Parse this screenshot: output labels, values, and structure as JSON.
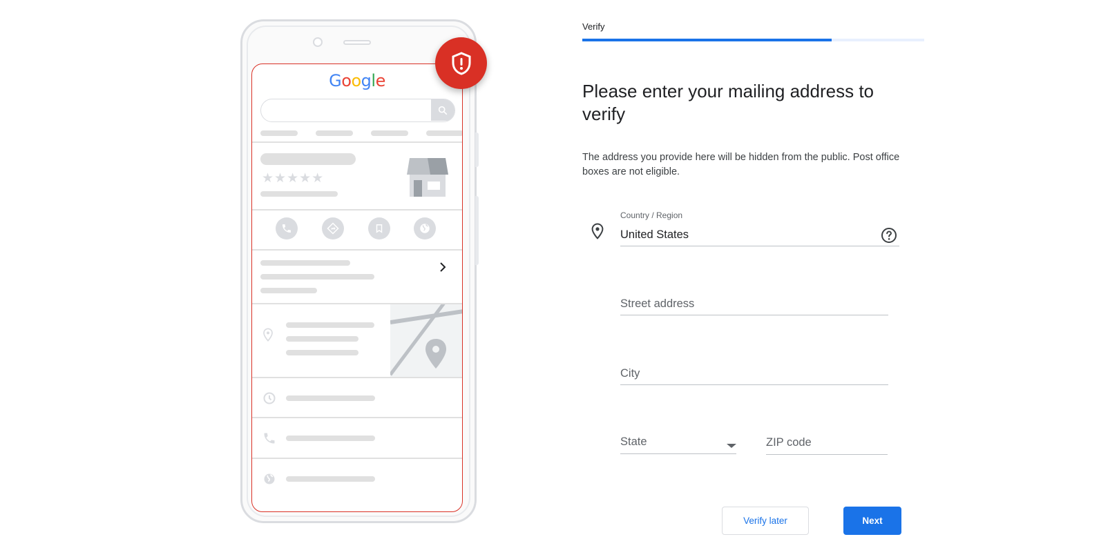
{
  "illustration": {
    "logo_letters": [
      "G",
      "o",
      "o",
      "g",
      "l",
      "e"
    ],
    "stars": "★★★★★",
    "chevron": "›"
  },
  "badge": {
    "icon": "shield-alert-icon",
    "color": "#d93025"
  },
  "wizard": {
    "step_label": "Verify",
    "progress": 0.73,
    "heading": "Please enter your mailing address to verify",
    "description": "The address you provide here will be hidden from the public. Post office boxes are not eligible."
  },
  "form": {
    "country": {
      "label": "Country / Region",
      "value": "United States",
      "icon": "location-pin-icon",
      "help_icon": "help-circle-icon"
    },
    "street": {
      "placeholder": "Street address"
    },
    "city": {
      "placeholder": "City"
    },
    "state": {
      "placeholder": "State",
      "icon": "dropdown-caret-icon"
    },
    "zip": {
      "placeholder": "ZIP code"
    }
  },
  "actions": {
    "verify_later": "Verify later",
    "next": "Next"
  },
  "colors": {
    "accent": "#1a73e8",
    "alert": "#d93025"
  }
}
